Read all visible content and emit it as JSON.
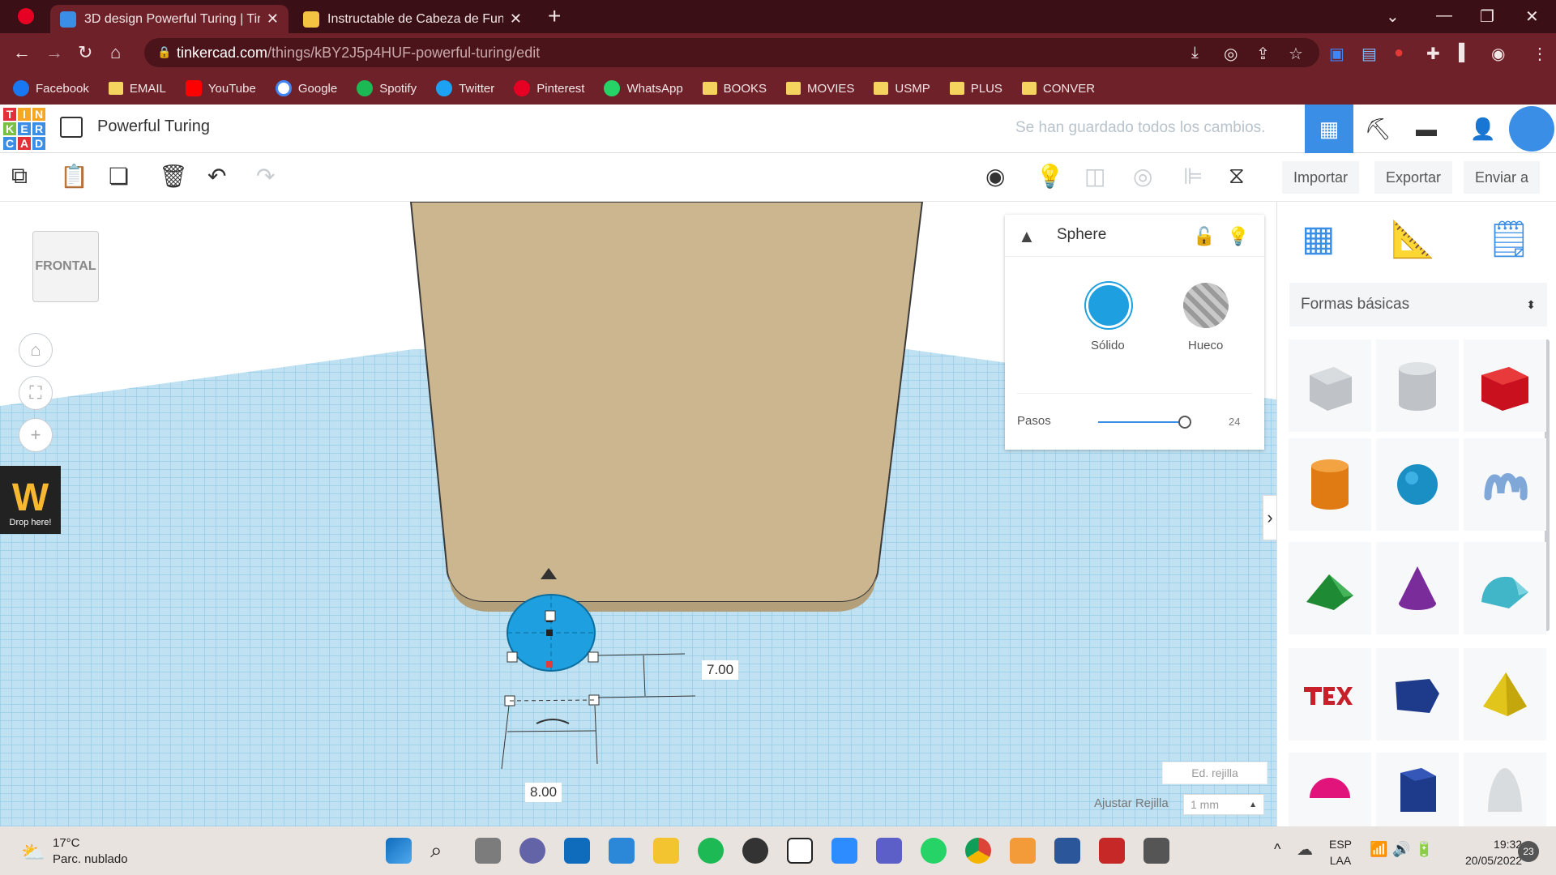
{
  "browser": {
    "tabs": [
      {
        "title": "3D design Powerful Turing | Tinkercad",
        "active": true
      },
      {
        "title": "Instructable de Cabeza de Funko",
        "active": false
      }
    ],
    "new_tab": "+",
    "url_host": "tinkercad.com",
    "url_path": "/things/kBY2J5p4HUF-powerful-turing/edit",
    "bookmarks": [
      {
        "label": "Facebook",
        "type": "site",
        "color": "#1877f2"
      },
      {
        "label": "EMAIL",
        "type": "folder"
      },
      {
        "label": "YouTube",
        "type": "site",
        "color": "#ff0000"
      },
      {
        "label": "Google",
        "type": "site",
        "color": "#4285f4"
      },
      {
        "label": "Spotify",
        "type": "site",
        "color": "#1db954"
      },
      {
        "label": "Twitter",
        "type": "site",
        "color": "#1da1f2"
      },
      {
        "label": "Pinterest",
        "type": "site",
        "color": "#e60023"
      },
      {
        "label": "WhatsApp",
        "type": "site",
        "color": "#25d366"
      },
      {
        "label": "BOOKS",
        "type": "folder"
      },
      {
        "label": "MOVIES",
        "type": "folder"
      },
      {
        "label": "USMP",
        "type": "folder"
      },
      {
        "label": "PLUS",
        "type": "folder"
      },
      {
        "label": "CONVER",
        "type": "folder"
      }
    ]
  },
  "app": {
    "logo_letters": [
      "T",
      "I",
      "N",
      "K",
      "E",
      "R",
      "C",
      "A",
      "D"
    ],
    "logo_colors": [
      "#e2303b",
      "#f5a623",
      "#f5a623",
      "#7ac143",
      "#3a8ee6",
      "#3a8ee6",
      "#3a8ee6",
      "#e2303b",
      "#3a8ee6"
    ],
    "design_title": "Powerful Turing",
    "save_status": "Se han guardado todos los cambios.",
    "import_label": "Importar",
    "export_label": "Exportar",
    "send_label": "Enviar a"
  },
  "workplane": {
    "viewcube_label": "FRONTAL",
    "drop_here": "Drop here!",
    "drop_logo": "W",
    "dim_height": "7.00",
    "dim_width": "8.00",
    "grid_edit": "Ed. rejilla",
    "snap_label": "Ajustar Rejilla",
    "snap_value": "1 mm"
  },
  "inspector": {
    "title": "Sphere",
    "solid_label": "Sólido",
    "hole_label": "Hueco",
    "steps_label": "Pasos",
    "steps_value": "24",
    "steps_fraction": 0.9,
    "solid_color": "#1ea0e0"
  },
  "library": {
    "category": "Formas básicas",
    "shapes": [
      "box-hole",
      "cylinder-hole",
      "box",
      "cylinder",
      "sphere",
      "scribble",
      "roof",
      "cone",
      "round-roof",
      "text",
      "wedge",
      "pyramid",
      "half-sphere",
      "polygon",
      "paraboloid"
    ]
  },
  "taskbar": {
    "temp": "17°C",
    "weather": "Parc. nublado",
    "lang1": "ESP",
    "lang2": "LAA",
    "time": "19:32",
    "date": "20/05/2022",
    "notifications": "23"
  }
}
